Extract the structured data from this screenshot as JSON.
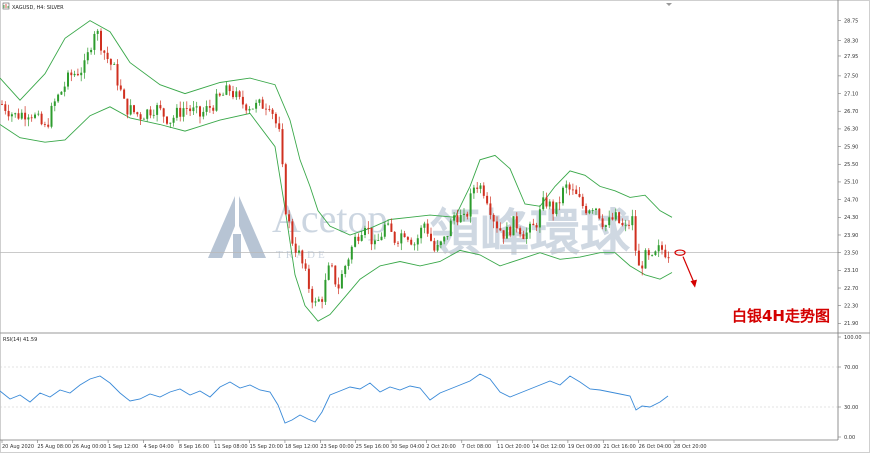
{
  "header": {
    "symbol_label": "XAGUSD, H4:  SILVER"
  },
  "rsi_header": {
    "label": "RSI(14) 41.59"
  },
  "watermark": {
    "main": "Acetop",
    "cn": "領峰環球",
    "sub": "TRADE"
  },
  "annotation": {
    "text": "白银4H走势图",
    "color": "#d40000"
  },
  "colors": {
    "bull": "#2e9c2e",
    "bear": "#d03020",
    "band": "#3aa84a",
    "rsi_line": "#3a8ad8",
    "current_price_line": "#b8b8b8",
    "arrow": "#d40000",
    "watermark": "#b7c4d4"
  },
  "chart_data": [
    {
      "type": "candlestick",
      "symbol": "XAGUSD",
      "timeframe": "H4",
      "name": "SILVER",
      "ylim": [
        21.75,
        28.9
      ],
      "y_ticks": [
        "28.75",
        "28.30",
        "27.95",
        "27.50",
        "27.10",
        "26.70",
        "26.30",
        "25.90",
        "25.50",
        "25.10",
        "24.70",
        "24.30",
        "23.90",
        "23.50",
        "23.10",
        "22.70",
        "22.30",
        "21.90"
      ],
      "x_ticks": [
        "20 Aug 2020",
        "25 Aug 08:00",
        "26 Aug 00:00",
        "1 Sep 12:00",
        "4 Sep 04:00",
        "8 Sep 16:00",
        "11 Sep 08:00",
        "15 Sep 20:00",
        "18 Sep 12:00",
        "23 Sep 00:00",
        "25 Sep 16:00",
        "30 Sep 04:00",
        "2 Oct 20:00",
        "7 Oct 08:00",
        "11 Oct 20:00",
        "14 Oct 12:00",
        "19 Oct 00:00",
        "21 Oct 16:00",
        "26 Oct 04:00",
        "28 Oct 20:00"
      ],
      "indicator": "Bollinger Bands",
      "bollinger_upper_path": [
        [
          0,
          27.45
        ],
        [
          20,
          26.95
        ],
        [
          45,
          27.55
        ],
        [
          65,
          28.35
        ],
        [
          90,
          28.75
        ],
        [
          110,
          28.5
        ],
        [
          130,
          27.8
        ],
        [
          160,
          27.3
        ],
        [
          185,
          27.1
        ],
        [
          220,
          27.35
        ],
        [
          250,
          27.45
        ],
        [
          275,
          27.3
        ],
        [
          290,
          26.5
        ],
        [
          300,
          25.6
        ],
        [
          310,
          25.0
        ],
        [
          318,
          24.45
        ],
        [
          330,
          24.1
        ],
        [
          350,
          23.9
        ],
        [
          370,
          24.05
        ],
        [
          390,
          24.25
        ],
        [
          410,
          24.3
        ],
        [
          430,
          24.35
        ],
        [
          455,
          24.3
        ],
        [
          470,
          25.0
        ],
        [
          480,
          25.6
        ],
        [
          495,
          25.7
        ],
        [
          510,
          25.4
        ],
        [
          525,
          24.6
        ],
        [
          540,
          24.55
        ],
        [
          555,
          25.0
        ],
        [
          570,
          25.35
        ],
        [
          585,
          25.25
        ],
        [
          600,
          25.0
        ],
        [
          615,
          24.9
        ],
        [
          630,
          24.75
        ],
        [
          645,
          24.8
        ],
        [
          660,
          24.45
        ],
        [
          672,
          24.3
        ]
      ],
      "bollinger_lower_path": [
        [
          0,
          26.4
        ],
        [
          20,
          26.1
        ],
        [
          45,
          26.0
        ],
        [
          65,
          26.05
        ],
        [
          90,
          26.6
        ],
        [
          110,
          26.8
        ],
        [
          130,
          26.55
        ],
        [
          160,
          26.4
        ],
        [
          185,
          26.25
        ],
        [
          220,
          26.5
        ],
        [
          250,
          26.65
        ],
        [
          275,
          25.9
        ],
        [
          285,
          24.5
        ],
        [
          295,
          23.0
        ],
        [
          305,
          22.3
        ],
        [
          318,
          21.95
        ],
        [
          330,
          22.1
        ],
        [
          345,
          22.5
        ],
        [
          360,
          22.9
        ],
        [
          380,
          23.2
        ],
        [
          400,
          23.3
        ],
        [
          420,
          23.2
        ],
        [
          440,
          23.3
        ],
        [
          460,
          23.55
        ],
        [
          480,
          23.45
        ],
        [
          500,
          23.2
        ],
        [
          520,
          23.35
        ],
        [
          540,
          23.5
        ],
        [
          560,
          23.35
        ],
        [
          580,
          23.4
        ],
        [
          600,
          23.5
        ],
        [
          615,
          23.5
        ],
        [
          630,
          23.2
        ],
        [
          645,
          23.0
        ],
        [
          660,
          22.9
        ],
        [
          672,
          23.05
        ]
      ],
      "current_price": 23.5,
      "candles_close_path": [
        [
          0,
          26.9
        ],
        [
          15,
          26.6
        ],
        [
          30,
          26.7
        ],
        [
          45,
          26.3
        ],
        [
          55,
          26.9
        ],
        [
          70,
          27.5
        ],
        [
          85,
          27.7
        ],
        [
          95,
          28.6
        ],
        [
          105,
          28.0
        ],
        [
          115,
          27.6
        ],
        [
          125,
          26.8
        ],
        [
          140,
          26.6
        ],
        [
          155,
          26.8
        ],
        [
          170,
          26.5
        ],
        [
          185,
          26.8
        ],
        [
          200,
          26.6
        ],
        [
          215,
          26.9
        ],
        [
          230,
          27.2
        ],
        [
          240,
          26.9
        ],
        [
          255,
          26.8
        ],
        [
          270,
          26.9
        ],
        [
          280,
          26.1
        ],
        [
          285,
          24.6
        ],
        [
          292,
          23.8
        ],
        [
          300,
          23.4
        ],
        [
          308,
          22.8
        ],
        [
          315,
          22.3
        ],
        [
          322,
          22.5
        ],
        [
          330,
          23.2
        ],
        [
          338,
          22.7
        ],
        [
          345,
          23.2
        ],
        [
          355,
          23.8
        ],
        [
          365,
          24.2
        ],
        [
          375,
          23.6
        ],
        [
          385,
          24.1
        ],
        [
          395,
          23.8
        ],
        [
          405,
          24.0
        ],
        [
          415,
          23.7
        ],
        [
          425,
          24.2
        ],
        [
          435,
          23.5
        ],
        [
          445,
          23.8
        ],
        [
          455,
          24.4
        ],
        [
          465,
          24.2
        ],
        [
          475,
          25.1
        ],
        [
          485,
          24.9
        ],
        [
          495,
          24.2
        ],
        [
          505,
          23.9
        ],
        [
          515,
          24.2
        ],
        [
          525,
          23.9
        ],
        [
          535,
          24.1
        ],
        [
          545,
          24.7
        ],
        [
          555,
          24.4
        ],
        [
          565,
          25.0
        ],
        [
          575,
          24.8
        ],
        [
          585,
          24.5
        ],
        [
          595,
          24.6
        ],
        [
          605,
          24.1
        ],
        [
          615,
          24.3
        ],
        [
          625,
          24.0
        ],
        [
          632,
          24.3
        ],
        [
          638,
          23.1
        ],
        [
          645,
          23.4
        ],
        [
          652,
          23.3
        ],
        [
          660,
          23.6
        ],
        [
          668,
          23.5
        ]
      ],
      "prediction_marker": {
        "y": 23.5
      }
    },
    {
      "type": "line",
      "name": "RSI(14)",
      "value": 41.59,
      "ylim": [
        0,
        100
      ],
      "y_ticks": [
        "100.00",
        "70.00",
        "30.00",
        "0.00"
      ],
      "path": [
        [
          0,
          46
        ],
        [
          10,
          38
        ],
        [
          20,
          42
        ],
        [
          30,
          35
        ],
        [
          40,
          44
        ],
        [
          50,
          40
        ],
        [
          60,
          47
        ],
        [
          70,
          44
        ],
        [
          80,
          52
        ],
        [
          90,
          58
        ],
        [
          100,
          61
        ],
        [
          110,
          54
        ],
        [
          120,
          44
        ],
        [
          130,
          36
        ],
        [
          140,
          38
        ],
        [
          150,
          43
        ],
        [
          160,
          40
        ],
        [
          170,
          45
        ],
        [
          180,
          48
        ],
        [
          190,
          42
        ],
        [
          200,
          46
        ],
        [
          210,
          40
        ],
        [
          220,
          50
        ],
        [
          230,
          55
        ],
        [
          240,
          49
        ],
        [
          250,
          52
        ],
        [
          260,
          47
        ],
        [
          270,
          45
        ],
        [
          278,
          32
        ],
        [
          285,
          14
        ],
        [
          292,
          17
        ],
        [
          300,
          22
        ],
        [
          308,
          18
        ],
        [
          315,
          15
        ],
        [
          322,
          25
        ],
        [
          330,
          42
        ],
        [
          340,
          46
        ],
        [
          350,
          50
        ],
        [
          360,
          48
        ],
        [
          370,
          54
        ],
        [
          380,
          45
        ],
        [
          390,
          50
        ],
        [
          400,
          47
        ],
        [
          410,
          51
        ],
        [
          420,
          49
        ],
        [
          430,
          37
        ],
        [
          440,
          44
        ],
        [
          450,
          48
        ],
        [
          460,
          52
        ],
        [
          470,
          56
        ],
        [
          480,
          63
        ],
        [
          490,
          58
        ],
        [
          500,
          45
        ],
        [
          510,
          40
        ],
        [
          520,
          44
        ],
        [
          530,
          48
        ],
        [
          540,
          52
        ],
        [
          550,
          56
        ],
        [
          560,
          52
        ],
        [
          570,
          61
        ],
        [
          580,
          55
        ],
        [
          590,
          48
        ],
        [
          600,
          47
        ],
        [
          610,
          45
        ],
        [
          620,
          43
        ],
        [
          630,
          41
        ],
        [
          636,
          27
        ],
        [
          642,
          31
        ],
        [
          650,
          30
        ],
        [
          660,
          35
        ],
        [
          668,
          41
        ]
      ]
    }
  ]
}
